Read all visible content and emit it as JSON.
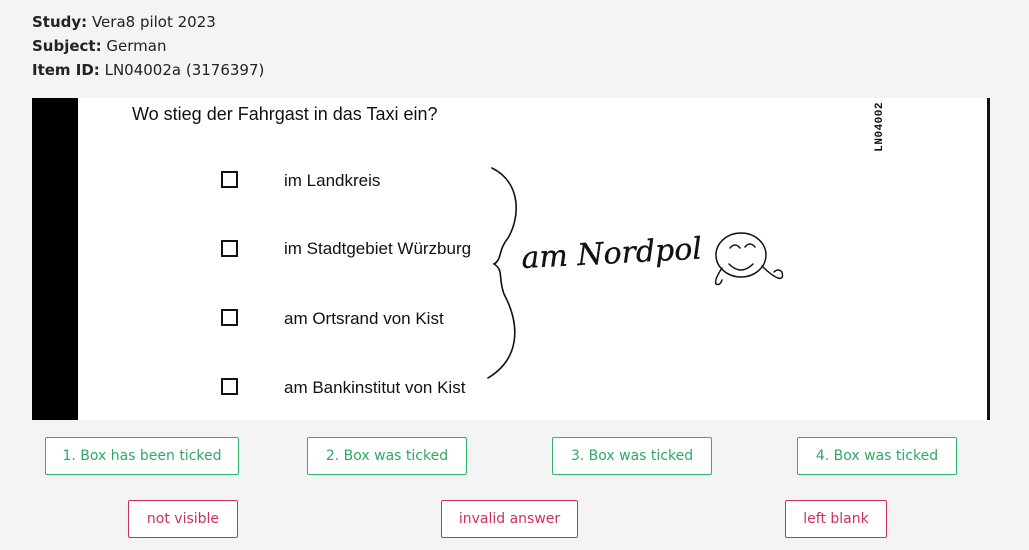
{
  "meta": {
    "study_label": "Study:",
    "study_value": "Vera8 pilot 2023",
    "subject_label": "Subject:",
    "subject_value": "German",
    "item_label": "Item ID:",
    "item_value": "LN04002a (3176397)"
  },
  "scan": {
    "question": "Wo stieg der Fahrgast in das Taxi ein?",
    "code": "LN04002",
    "options": [
      "im Landkreis",
      "im Stadtgebiet Würzburg",
      "am Ortsrand von Kist",
      "am Bankinstitut von Kist"
    ],
    "handwriting": "am Nordpol"
  },
  "buttons": {
    "tick": [
      "1. Box has been ticked",
      "2. Box was ticked",
      "3. Box was ticked",
      "4. Box was ticked"
    ],
    "not_visible": "not visible",
    "invalid_answer": "invalid answer",
    "left_blank": "left blank"
  },
  "colors": {
    "green": "#2fb36b",
    "red": "#cf2f5c",
    "background": "#f4f4f4"
  }
}
